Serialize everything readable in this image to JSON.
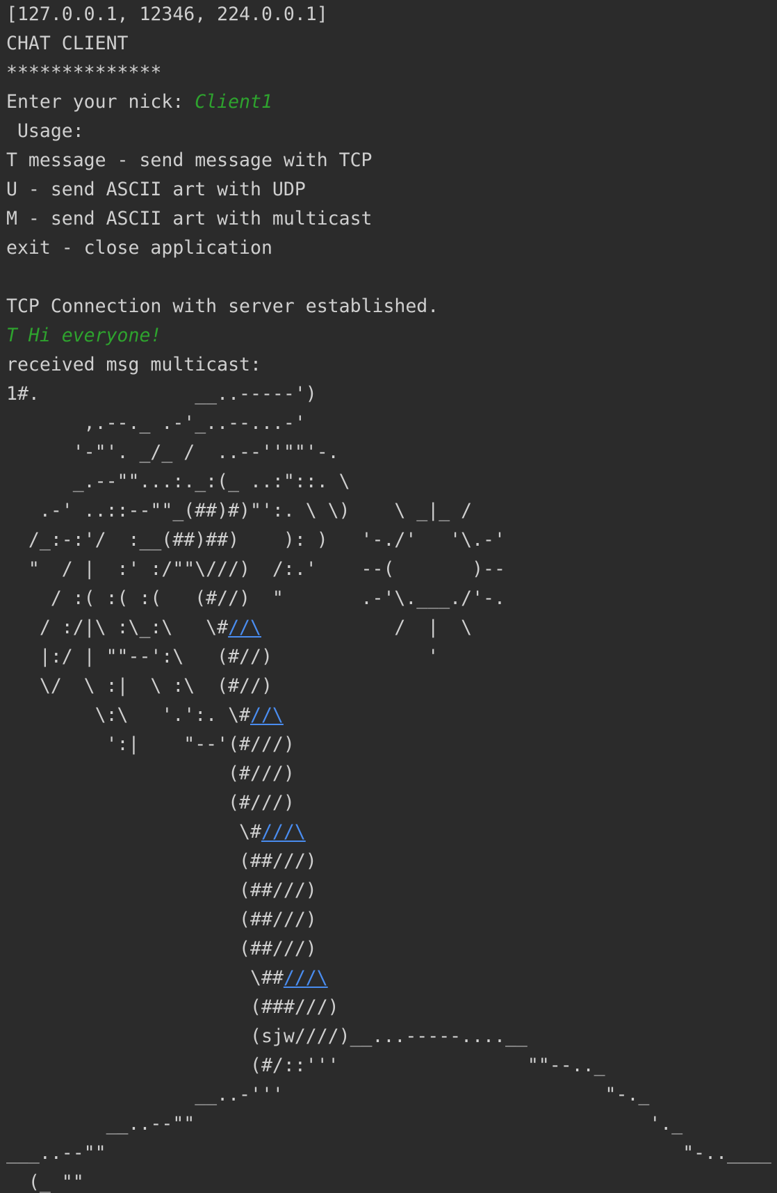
{
  "console": {
    "lines": [
      [
        {
          "t": "[127.0.0.1, 12346, 224.0.0.1]",
          "k": "plain"
        }
      ],
      [
        {
          "t": "CHAT CLIENT",
          "k": "plain"
        }
      ],
      [
        {
          "t": "**************",
          "k": "plain"
        }
      ],
      [
        {
          "t": "Enter your nick: ",
          "k": "plain"
        },
        {
          "t": "Client1",
          "k": "input"
        }
      ],
      [
        {
          "t": " Usage:",
          "k": "plain"
        }
      ],
      [
        {
          "t": "T message - send message with TCP",
          "k": "plain"
        }
      ],
      [
        {
          "t": "U - send ASCII art with UDP",
          "k": "plain"
        }
      ],
      [
        {
          "t": "M - send ASCII art with multicast",
          "k": "plain"
        }
      ],
      [
        {
          "t": "exit - close application",
          "k": "plain"
        }
      ],
      [
        {
          "t": "",
          "k": "plain"
        }
      ],
      [
        {
          "t": "TCP Connection with server established.",
          "k": "plain"
        }
      ],
      [
        {
          "t": "T Hi everyone!",
          "k": "input"
        }
      ],
      [
        {
          "t": "received msg multicast:",
          "k": "plain"
        }
      ],
      [
        {
          "t": "1#.              __..-----')",
          "k": "plain"
        }
      ],
      [
        {
          "t": "       ,.--._ .-'_..--...-'",
          "k": "plain"
        }
      ],
      [
        {
          "t": "      '-\"'. _/_ /  ..--''\"\"'-.",
          "k": "plain"
        }
      ],
      [
        {
          "t": "      _.--\"\"...:._:(_ ..:\"::. \\",
          "k": "plain"
        }
      ],
      [
        {
          "t": "   .-' ..::--\"\"_(##)#)\"':. \\ \\)    \\ _|_ /",
          "k": "plain"
        }
      ],
      [
        {
          "t": "  /_:-:'/  :__(##)##)    ): )   '-./'   '\\.-'",
          "k": "plain"
        }
      ],
      [
        {
          "t": "  \"  / |  :' :/\"\"\\///)  /:.'    --(       )--",
          "k": "plain"
        }
      ],
      [
        {
          "t": "    / :( :( :(   (#//)  \"       .-'\\.___./'-.",
          "k": "plain"
        }
      ],
      [
        {
          "t": "   / :/|\\ :\\_:\\   \\#",
          "k": "plain"
        },
        {
          "t": "//\\",
          "k": "link"
        },
        {
          "t": "            /  |  \\",
          "k": "plain"
        }
      ],
      [
        {
          "t": "   |:/ | \"\"--':\\   (#//)              '",
          "k": "plain"
        }
      ],
      [
        {
          "t": "   \\/  \\ :|  \\ :\\  (#//)",
          "k": "plain"
        }
      ],
      [
        {
          "t": "        \\:\\   '.':. \\#",
          "k": "plain"
        },
        {
          "t": "//\\",
          "k": "link"
        }
      ],
      [
        {
          "t": "         ':|    \"--'(#///)",
          "k": "plain"
        }
      ],
      [
        {
          "t": "                    (#///)",
          "k": "plain"
        }
      ],
      [
        {
          "t": "                    (#///)",
          "k": "plain"
        }
      ],
      [
        {
          "t": "                     \\#",
          "k": "plain"
        },
        {
          "t": "///\\",
          "k": "link"
        }
      ],
      [
        {
          "t": "                     (##///)",
          "k": "plain"
        }
      ],
      [
        {
          "t": "                     (##///)",
          "k": "plain"
        }
      ],
      [
        {
          "t": "                     (##///)",
          "k": "plain"
        }
      ],
      [
        {
          "t": "                     (##///)",
          "k": "plain"
        }
      ],
      [
        {
          "t": "                      \\##",
          "k": "plain"
        },
        {
          "t": "///\\",
          "k": "link"
        }
      ],
      [
        {
          "t": "                      (###///)",
          "k": "plain"
        }
      ],
      [
        {
          "t": "                      (sjw////)__...-----....__",
          "k": "plain"
        }
      ],
      [
        {
          "t": "                      (#/::'''                 \"\"--.._",
          "k": "plain"
        }
      ],
      [
        {
          "t": "                 __..-'''                             \"-._",
          "k": "plain"
        }
      ],
      [
        {
          "t": "         __..--\"\"                                         '._",
          "k": "plain"
        }
      ],
      [
        {
          "t": "___..--\"\"                                                    \"-..____",
          "k": "plain"
        }
      ],
      [
        {
          "t": "  (_ \"\"",
          "k": "plain"
        }
      ]
    ]
  }
}
